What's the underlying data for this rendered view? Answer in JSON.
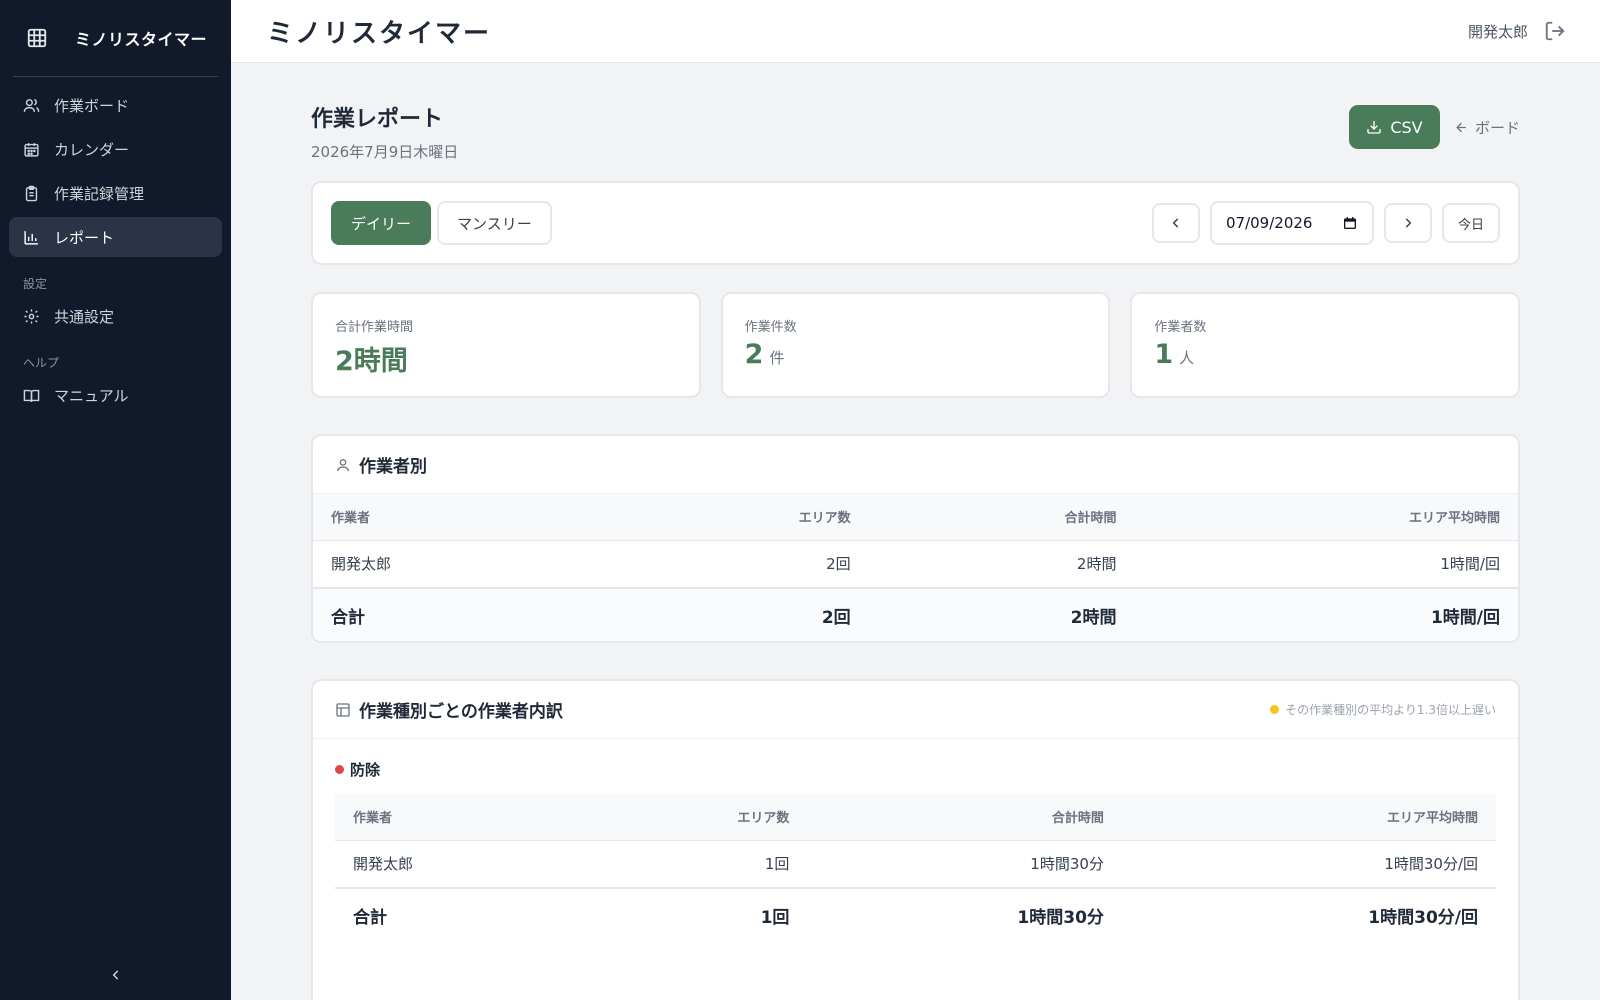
{
  "sidebar": {
    "brand": "ミノリスタイマー",
    "items": [
      {
        "label": "作業ボード",
        "icon": "users-icon"
      },
      {
        "label": "カレンダー",
        "icon": "calendar-icon"
      },
      {
        "label": "作業記録管理",
        "icon": "clipboard-icon"
      },
      {
        "label": "レポート",
        "icon": "bar-chart-icon",
        "active": true
      }
    ],
    "section_settings": "設定",
    "settings_item": "共通設定",
    "section_help": "ヘルプ",
    "help_item": "マニュアル"
  },
  "header": {
    "title": "ミノリスタイマー",
    "user": "開発太郎"
  },
  "page": {
    "title": "作業レポート",
    "date": "2026年7月9日木曜日",
    "csv_label": "CSV",
    "back_label": "ボード"
  },
  "filters": {
    "tabs": [
      "デイリー",
      "マンスリー"
    ],
    "active_tab": "デイリー",
    "date_value": "07/09/2026",
    "today_label": "今日"
  },
  "stats": [
    {
      "label": "合計作業時間",
      "value": "2時間",
      "unit": ""
    },
    {
      "label": "作業件数",
      "value": "2",
      "unit": "件"
    },
    {
      "label": "作業者数",
      "value": "1",
      "unit": "人"
    }
  ],
  "by_worker": {
    "title": "作業者別",
    "columns": [
      "作業者",
      "エリア数",
      "合計時間",
      "エリア平均時間"
    ],
    "rows": [
      [
        "開発太郎",
        "2回",
        "2時間",
        "1時間/回"
      ]
    ],
    "total": [
      "合計",
      "2回",
      "2時間",
      "1時間/回"
    ]
  },
  "breakdown": {
    "title": "作業種別ごとの作業者内訳",
    "note": "その作業種別の平均より1.3倍以上遅い",
    "note_color": "#f5c518",
    "category": {
      "name": "防除",
      "color": "#e0474c",
      "columns": [
        "作業者",
        "エリア数",
        "合計時間",
        "エリア平均時間"
      ],
      "rows": [
        [
          "開発太郎",
          "1回",
          "1時間30分",
          "1時間30分/回"
        ]
      ],
      "total": [
        "合計",
        "1回",
        "1時間30分",
        "1時間30分/回"
      ]
    }
  },
  "colors": {
    "accent": "#4a7c59",
    "sidebar_bg": "#111a2b"
  }
}
